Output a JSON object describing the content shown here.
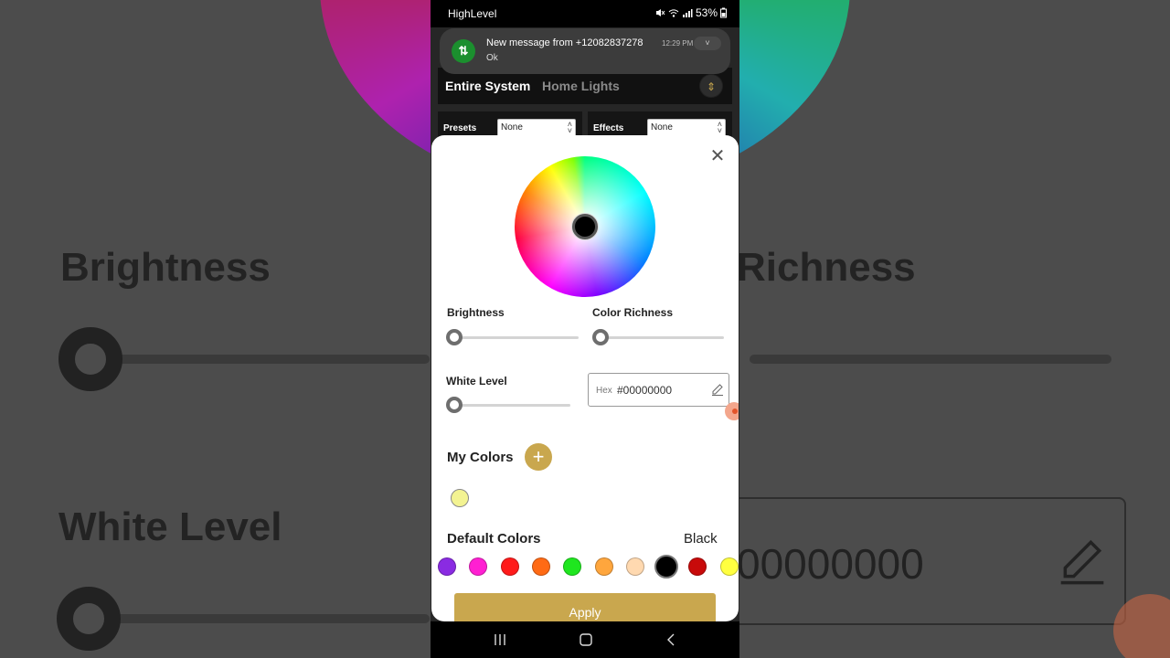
{
  "background": {
    "brightness_label": "Brightness",
    "richness_label": "Richness",
    "white_level_label": "White Level",
    "hex_value": "00000000",
    "pencil_icon": "pencil-icon"
  },
  "status_bar": {
    "app_name": "HighLevel",
    "battery": "53%",
    "icons": [
      "mute-icon",
      "wifi-icon",
      "signal-icon",
      "battery-icon"
    ]
  },
  "notification": {
    "icon": "app-notification-icon",
    "title": "New message from +12082837278",
    "time": "12:29 PM",
    "body": "Ok",
    "expand_icon": "chevron-down-icon"
  },
  "header": {
    "tab_active": "Entire System",
    "tab_inactive": "Home Lights",
    "switch_icon": "up-down-chevron-icon"
  },
  "selectors": {
    "presets_label": "Presets",
    "presets_value": "None",
    "effects_label": "Effects",
    "effects_value": "None"
  },
  "modal": {
    "close_icon": "close-icon",
    "brightness_label": "Brightness",
    "brightness_value": 0,
    "richness_label": "Color Richness",
    "richness_value": 0,
    "white_label": "White Level",
    "white_value": 0,
    "hex_label": "Hex",
    "hex_value": "#00000000",
    "my_colors_title": "My Colors",
    "my_colors": [
      "#f3f392"
    ],
    "default_colors_title": "Default Colors",
    "selected_default_name": "Black",
    "default_colors": [
      "#8a2be2",
      "#ff1fd2",
      "#ff1a1a",
      "#ff6a14",
      "#1fe61f",
      "#ffa63d",
      "#ffd9b0",
      "#000000",
      "#c80a0a",
      "#ffff40"
    ],
    "selected_default_index": 7,
    "apply_label": "Apply"
  },
  "colors": {
    "accent": "#c9a74e",
    "notification_icon": "#1b8f2e"
  },
  "nav": {
    "icons": [
      "recent-apps-icon",
      "home-icon",
      "back-icon"
    ]
  }
}
